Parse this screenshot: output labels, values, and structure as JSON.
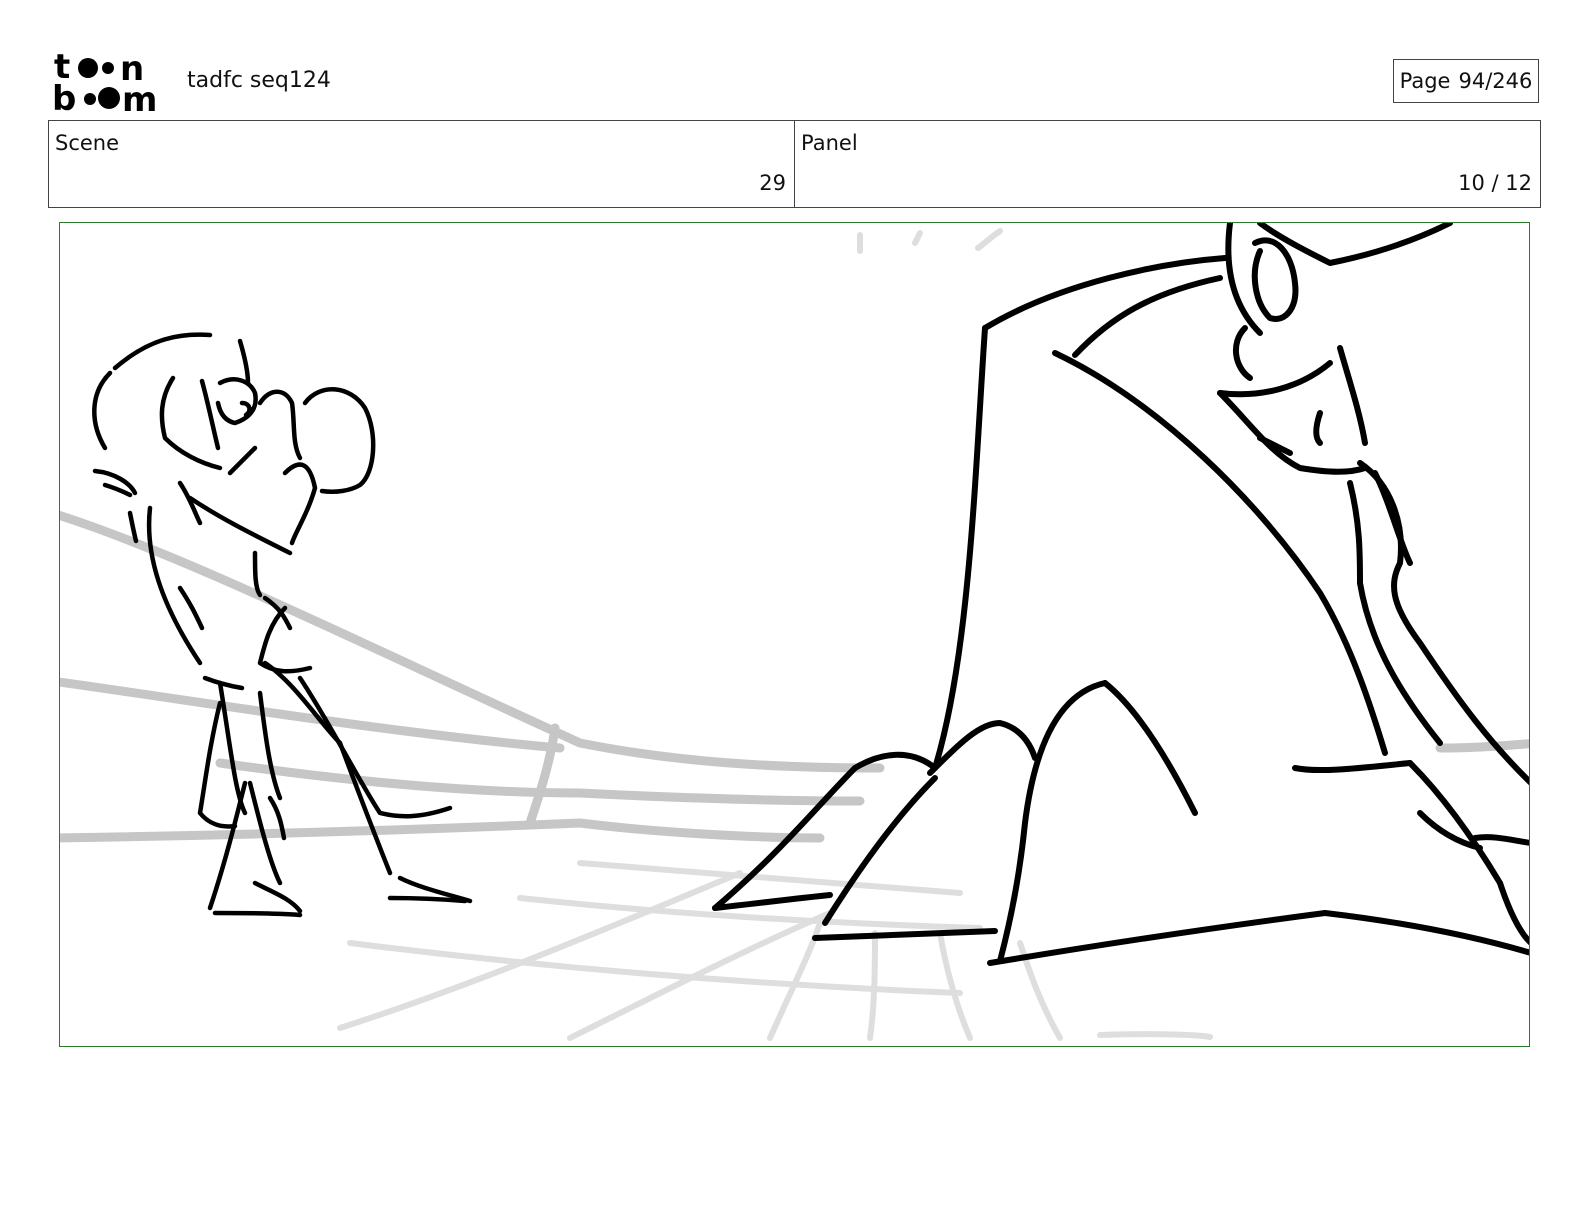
{
  "header": {
    "project_title": "tadfc seq124",
    "page_label": "Page",
    "page_value": "94/246"
  },
  "info": {
    "scene_label": "Scene",
    "scene_value": "29",
    "panel_label": "Panel",
    "panel_value": "10 / 12"
  },
  "colors": {
    "panel_border": "#2b7a2b",
    "sketch_line": "#000000",
    "background_line": "#c6c6c6"
  }
}
